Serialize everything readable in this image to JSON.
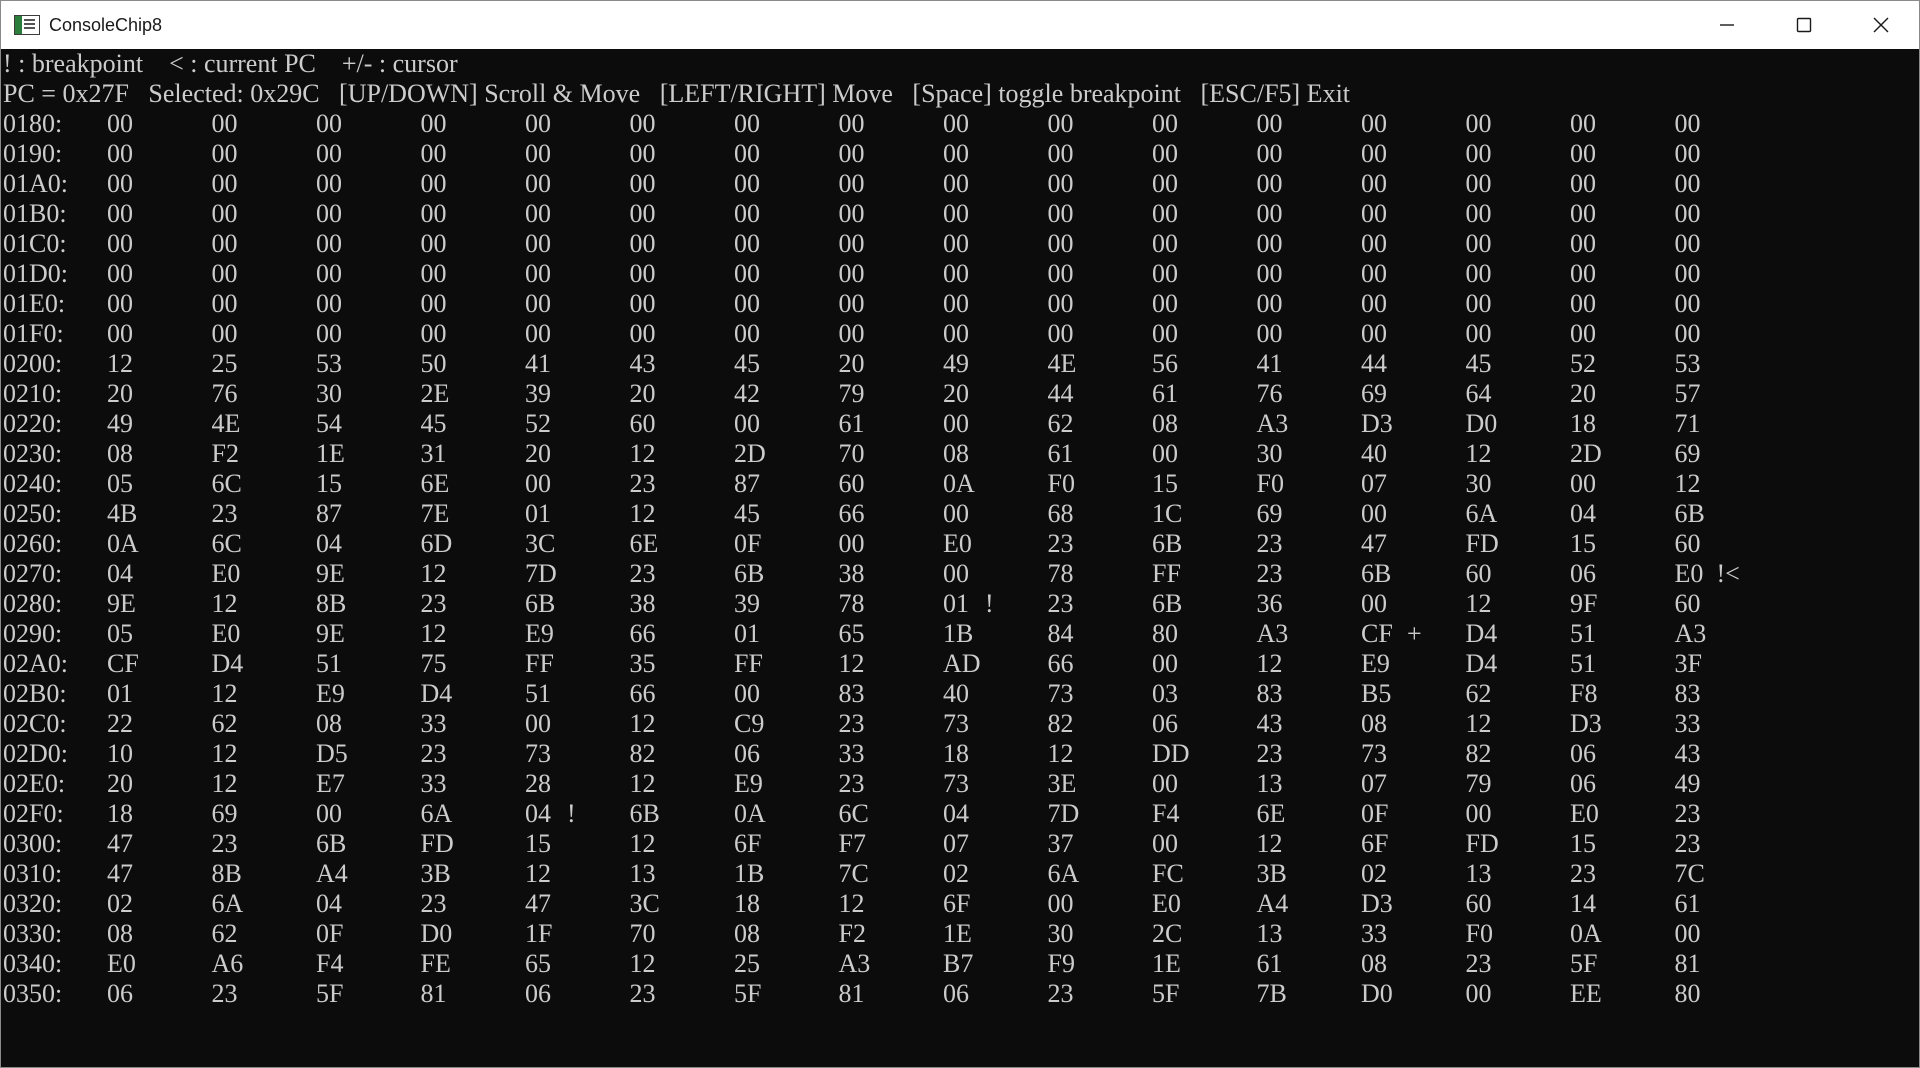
{
  "window": {
    "title": "ConsoleChip8",
    "icon": "console-app-icon",
    "controls": [
      "minimize-icon",
      "maximize-icon",
      "close-icon"
    ]
  },
  "console": {
    "legend": "! : breakpoint    < : current PC    +/- : cursor",
    "status": "PC = 0x27F   Selected: 0x29C   [UP/DOWN] Scroll & Move   [LEFT/RIGHT] Move   [Space] toggle breakpoint   [ESC/F5] Exit",
    "colors": {
      "background": "#0c0c0c",
      "text": "#cccccc"
    },
    "rows": [
      {
        "addr": "0180:",
        "bytes": [
          "00",
          "00",
          "00",
          "00",
          "00",
          "00",
          "00",
          "00",
          "00",
          "00",
          "00",
          "00",
          "00",
          "00",
          "00",
          "00"
        ]
      },
      {
        "addr": "0190:",
        "bytes": [
          "00",
          "00",
          "00",
          "00",
          "00",
          "00",
          "00",
          "00",
          "00",
          "00",
          "00",
          "00",
          "00",
          "00",
          "00",
          "00"
        ]
      },
      {
        "addr": "01A0:",
        "bytes": [
          "00",
          "00",
          "00",
          "00",
          "00",
          "00",
          "00",
          "00",
          "00",
          "00",
          "00",
          "00",
          "00",
          "00",
          "00",
          "00"
        ]
      },
      {
        "addr": "01B0:",
        "bytes": [
          "00",
          "00",
          "00",
          "00",
          "00",
          "00",
          "00",
          "00",
          "00",
          "00",
          "00",
          "00",
          "00",
          "00",
          "00",
          "00"
        ]
      },
      {
        "addr": "01C0:",
        "bytes": [
          "00",
          "00",
          "00",
          "00",
          "00",
          "00",
          "00",
          "00",
          "00",
          "00",
          "00",
          "00",
          "00",
          "00",
          "00",
          "00"
        ]
      },
      {
        "addr": "01D0:",
        "bytes": [
          "00",
          "00",
          "00",
          "00",
          "00",
          "00",
          "00",
          "00",
          "00",
          "00",
          "00",
          "00",
          "00",
          "00",
          "00",
          "00"
        ]
      },
      {
        "addr": "01E0:",
        "bytes": [
          "00",
          "00",
          "00",
          "00",
          "00",
          "00",
          "00",
          "00",
          "00",
          "00",
          "00",
          "00",
          "00",
          "00",
          "00",
          "00"
        ]
      },
      {
        "addr": "01F0:",
        "bytes": [
          "00",
          "00",
          "00",
          "00",
          "00",
          "00",
          "00",
          "00",
          "00",
          "00",
          "00",
          "00",
          "00",
          "00",
          "00",
          "00"
        ]
      },
      {
        "addr": "0200:",
        "bytes": [
          "12",
          "25",
          "53",
          "50",
          "41",
          "43",
          "45",
          "20",
          "49",
          "4E",
          "56",
          "41",
          "44",
          "45",
          "52",
          "53"
        ]
      },
      {
        "addr": "0210:",
        "bytes": [
          "20",
          "76",
          "30",
          "2E",
          "39",
          "20",
          "42",
          "79",
          "20",
          "44",
          "61",
          "76",
          "69",
          "64",
          "20",
          "57"
        ]
      },
      {
        "addr": "0220:",
        "bytes": [
          "49",
          "4E",
          "54",
          "45",
          "52",
          "60",
          "00",
          "61",
          "00",
          "62",
          "08",
          "A3",
          "D3",
          "D0",
          "18",
          "71"
        ]
      },
      {
        "addr": "0230:",
        "bytes": [
          "08",
          "F2",
          "1E",
          "31",
          "20",
          "12",
          "2D",
          "70",
          "08",
          "61",
          "00",
          "30",
          "40",
          "12",
          "2D",
          "69"
        ]
      },
      {
        "addr": "0240:",
        "bytes": [
          "05",
          "6C",
          "15",
          "6E",
          "00",
          "23",
          "87",
          "60",
          "0A",
          "F0",
          "15",
          "F0",
          "07",
          "30",
          "00",
          "12"
        ]
      },
      {
        "addr": "0250:",
        "bytes": [
          "4B",
          "23",
          "87",
          "7E",
          "01",
          "12",
          "45",
          "66",
          "00",
          "68",
          "1C",
          "69",
          "00",
          "6A",
          "04",
          "6B"
        ]
      },
      {
        "addr": "0260:",
        "bytes": [
          "0A",
          "6C",
          "04",
          "6D",
          "3C",
          "6E",
          "0F",
          "00",
          "E0",
          "23",
          "6B",
          "23",
          "47",
          "FD",
          "15",
          "60"
        ]
      },
      {
        "addr": "0270:",
        "bytes": [
          "04",
          "E0",
          "9E",
          "12",
          "7D",
          "23",
          "6B",
          "38",
          "00",
          "78",
          "FF",
          "23",
          "6B",
          "60",
          "06",
          "E0"
        ],
        "marks": {
          "15": "!<"
        }
      },
      {
        "addr": "0280:",
        "bytes": [
          "9E",
          "12",
          "8B",
          "23",
          "6B",
          "38",
          "39",
          "78",
          "01",
          "23",
          "6B",
          "36",
          "00",
          "12",
          "9F",
          "60"
        ],
        "marks": {
          "8": "!"
        }
      },
      {
        "addr": "0290:",
        "bytes": [
          "05",
          "E0",
          "9E",
          "12",
          "E9",
          "66",
          "01",
          "65",
          "1B",
          "84",
          "80",
          "A3",
          "CF",
          "D4",
          "51",
          "A3"
        ],
        "marks": {
          "12": "+"
        }
      },
      {
        "addr": "02A0:",
        "bytes": [
          "CF",
          "D4",
          "51",
          "75",
          "FF",
          "35",
          "FF",
          "12",
          "AD",
          "66",
          "00",
          "12",
          "E9",
          "D4",
          "51",
          "3F"
        ]
      },
      {
        "addr": "02B0:",
        "bytes": [
          "01",
          "12",
          "E9",
          "D4",
          "51",
          "66",
          "00",
          "83",
          "40",
          "73",
          "03",
          "83",
          "B5",
          "62",
          "F8",
          "83"
        ]
      },
      {
        "addr": "02C0:",
        "bytes": [
          "22",
          "62",
          "08",
          "33",
          "00",
          "12",
          "C9",
          "23",
          "73",
          "82",
          "06",
          "43",
          "08",
          "12",
          "D3",
          "33"
        ]
      },
      {
        "addr": "02D0:",
        "bytes": [
          "10",
          "12",
          "D5",
          "23",
          "73",
          "82",
          "06",
          "33",
          "18",
          "12",
          "DD",
          "23",
          "73",
          "82",
          "06",
          "43"
        ]
      },
      {
        "addr": "02E0:",
        "bytes": [
          "20",
          "12",
          "E7",
          "33",
          "28",
          "12",
          "E9",
          "23",
          "73",
          "3E",
          "00",
          "13",
          "07",
          "79",
          "06",
          "49"
        ]
      },
      {
        "addr": "02F0:",
        "bytes": [
          "18",
          "69",
          "00",
          "6A",
          "04",
          "6B",
          "0A",
          "6C",
          "04",
          "7D",
          "F4",
          "6E",
          "0F",
          "00",
          "E0",
          "23"
        ],
        "marks": {
          "4": "!"
        }
      },
      {
        "addr": "0300:",
        "bytes": [
          "47",
          "23",
          "6B",
          "FD",
          "15",
          "12",
          "6F",
          "F7",
          "07",
          "37",
          "00",
          "12",
          "6F",
          "FD",
          "15",
          "23"
        ]
      },
      {
        "addr": "0310:",
        "bytes": [
          "47",
          "8B",
          "A4",
          "3B",
          "12",
          "13",
          "1B",
          "7C",
          "02",
          "6A",
          "FC",
          "3B",
          "02",
          "13",
          "23",
          "7C"
        ]
      },
      {
        "addr": "0320:",
        "bytes": [
          "02",
          "6A",
          "04",
          "23",
          "47",
          "3C",
          "18",
          "12",
          "6F",
          "00",
          "E0",
          "A4",
          "D3",
          "60",
          "14",
          "61"
        ]
      },
      {
        "addr": "0330:",
        "bytes": [
          "08",
          "62",
          "0F",
          "D0",
          "1F",
          "70",
          "08",
          "F2",
          "1E",
          "30",
          "2C",
          "13",
          "33",
          "F0",
          "0A",
          "00"
        ]
      },
      {
        "addr": "0340:",
        "bytes": [
          "E0",
          "A6",
          "F4",
          "FE",
          "65",
          "12",
          "25",
          "A3",
          "B7",
          "F9",
          "1E",
          "61",
          "08",
          "23",
          "5F",
          "81"
        ]
      },
      {
        "addr": "0350:",
        "bytes": [
          "06",
          "23",
          "5F",
          "81",
          "06",
          "23",
          "5F",
          "81",
          "06",
          "23",
          "5F",
          "7B",
          "D0",
          "00",
          "EE",
          "80"
        ]
      }
    ]
  }
}
